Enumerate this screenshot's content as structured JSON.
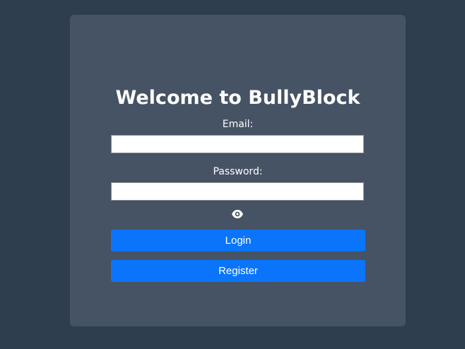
{
  "login_card": {
    "title": "Welcome to BullyBlock",
    "email": {
      "label": "Email:",
      "value": "",
      "placeholder": ""
    },
    "password": {
      "label": "Password:",
      "value": "",
      "placeholder": ""
    },
    "toggle_visibility_icon": "eye-icon",
    "login_label": "Login",
    "register_label": "Register"
  },
  "colors": {
    "page_background": "#2e3e4f",
    "card_background": "#455364",
    "button_accent": "#0a75fb",
    "text": "#ffffff"
  }
}
